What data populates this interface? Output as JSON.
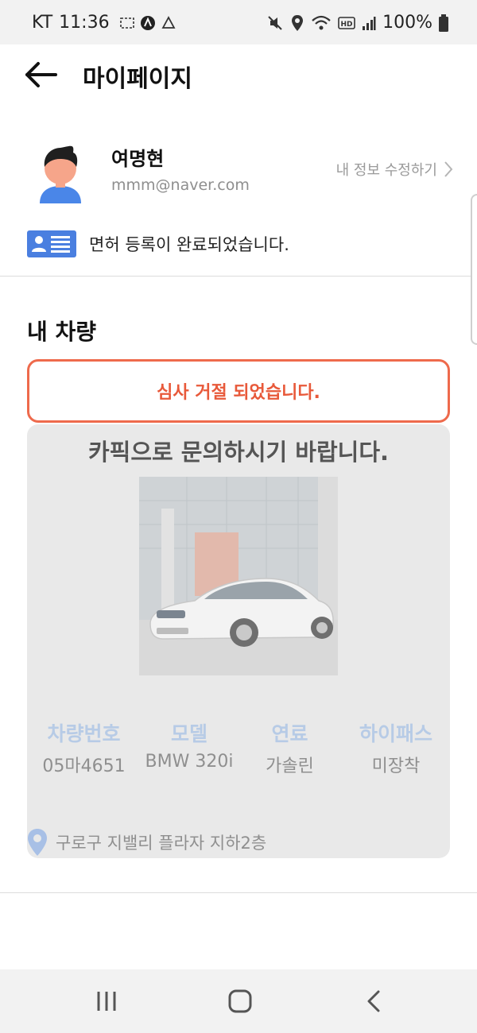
{
  "status_bar": {
    "carrier": "KT",
    "time": "11:36",
    "battery": "100%"
  },
  "app_bar": {
    "title": "마이페이지"
  },
  "profile": {
    "name": "여명현",
    "email": "mmm@naver.com",
    "edit_label": "내 정보 수정하기",
    "license_status": "면허 등록이 완료되었습니다."
  },
  "vehicle_section": {
    "title": "내 차량",
    "review_status": "심사 거절 되었습니다.",
    "contact_message": "카픽으로 문의하시기 바랍니다.",
    "specs": [
      {
        "label": "차량번호",
        "value": "05마4651"
      },
      {
        "label": "모델",
        "value": "BMW 320i"
      },
      {
        "label": "연료",
        "value": "가솔린"
      },
      {
        "label": "하이패스",
        "value": "미장착"
      }
    ],
    "location": "구로구 지밸리 플라자 지하2층"
  },
  "colors": {
    "accent_red": "#e8593a",
    "spec_label_blue": "#b7cbe6",
    "license_icon_blue": "#4a7fe0"
  }
}
